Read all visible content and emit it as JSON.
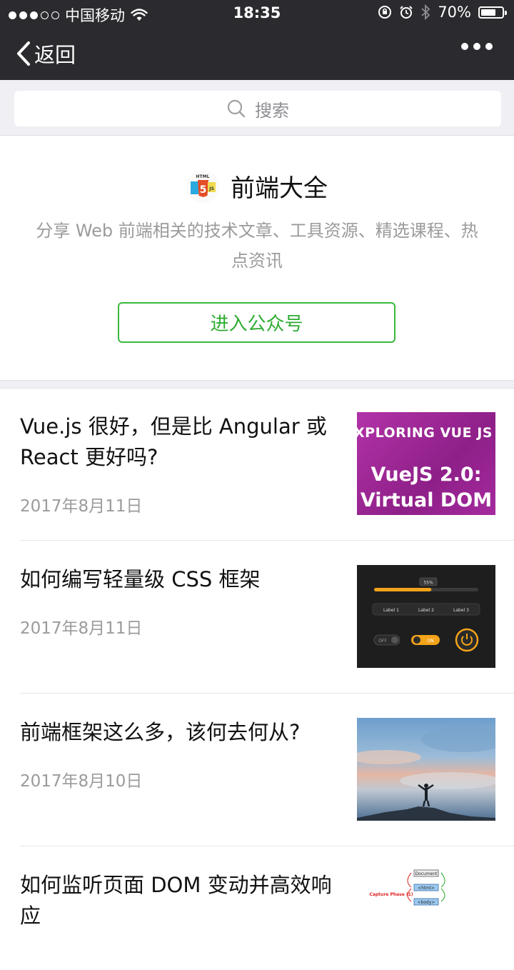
{
  "status_bar": {
    "carrier": "中国移动",
    "time": "18:35",
    "battery_text": "70%",
    "battery_level": 0.7,
    "signal_bars_filled": 3,
    "signal_bars_total": 5
  },
  "nav": {
    "back_label": "返回",
    "back_icon": "chevron-left-icon",
    "more_icon": "more-dots-icon"
  },
  "search": {
    "placeholder": "搜索",
    "icon": "search-icon"
  },
  "account": {
    "name": "前端大全",
    "logo_text_top": "HTML",
    "logo_text_mid": "5",
    "logo_text_right": "JS",
    "description": "分享 Web 前端相关的技术文章、工具资源、精选课程、热点资讯",
    "enter_button": "进入公众号"
  },
  "articles": [
    {
      "title": "Vue.js 很好，但是比 Angular 或 React 更好吗?",
      "date": "2017年8月11日",
      "thumb": {
        "line1": "XPLORING VUE JS",
        "line2": "VueJS 2.0:",
        "line3": "Virtual DOM"
      }
    },
    {
      "title": "如何编写轻量级 CSS 框架",
      "date": "2017年8月11日",
      "thumb": {
        "percent": "55%",
        "progress": 0.55,
        "labels": [
          "Label 1",
          "Label 2",
          "Label 3"
        ],
        "off": "OFF",
        "on": "ON"
      }
    },
    {
      "title": "前端框架这么多，该何去何从?",
      "date": "2017年8月10日"
    },
    {
      "title": "如何监听页面 DOM 变动并高效响应",
      "date": "",
      "thumb": {
        "node_document": "Document",
        "node_html": "<html>",
        "node_body": "<body>",
        "caption": "Capture Phase (1)"
      }
    }
  ],
  "colors": {
    "topbar": "#2b2b2f",
    "accent_green": "#2fac33",
    "muted_text": "#9b9b9b",
    "background_gray": "#efeff4"
  }
}
